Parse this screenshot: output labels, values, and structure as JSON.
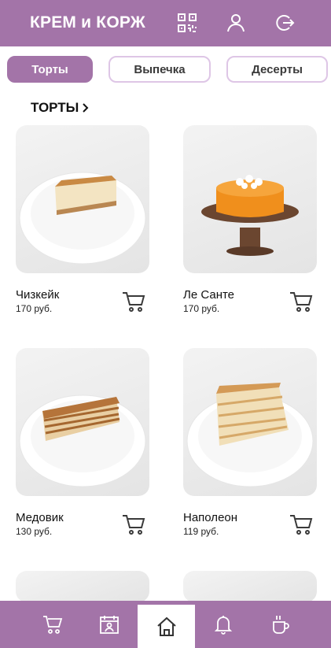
{
  "header": {
    "brand": "КРЕМ и КОРЖ",
    "icons": [
      "qr-code-icon",
      "user-icon",
      "logout-icon"
    ]
  },
  "categories": [
    {
      "label": "Торты",
      "active": true
    },
    {
      "label": "Выпечка",
      "active": false
    },
    {
      "label": "Десерты",
      "active": false
    }
  ],
  "section": {
    "title": "ТОРТЫ"
  },
  "products": [
    {
      "name": "Чизкейк",
      "price": "170 руб."
    },
    {
      "name": "Ле Санте",
      "price": "170 руб."
    },
    {
      "name": "Медовик",
      "price": "130 руб."
    },
    {
      "name": "Наполеон",
      "price": "119 руб."
    }
  ],
  "bottom_nav": [
    "cart-icon",
    "calendar-icon",
    "home-icon",
    "bell-icon",
    "coffee-cup-icon"
  ],
  "colors": {
    "accent": "#a374a8",
    "chip_border": "#dec6e6"
  }
}
